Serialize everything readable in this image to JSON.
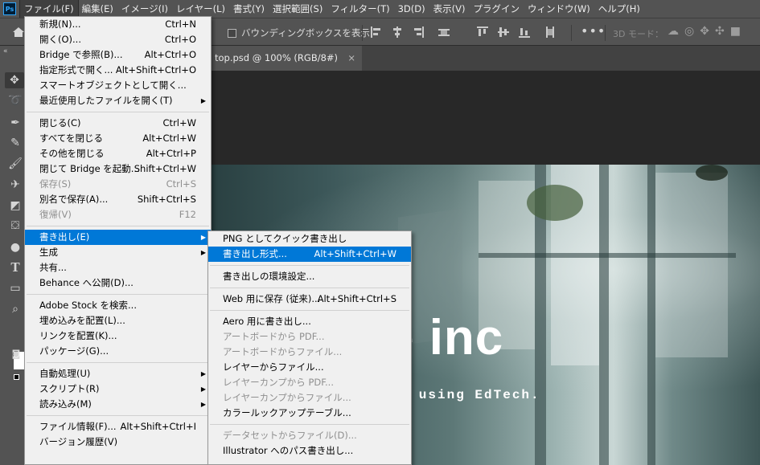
{
  "menubar": {
    "logo": "Ps",
    "items": [
      "ファイル(F)",
      "編集(E)",
      "イメージ(I)",
      "レイヤー(L)",
      "書式(Y)",
      "選択範囲(S)",
      "フィルター(T)",
      "3D(D)",
      "表示(V)",
      "プラグイン",
      "ウィンドウ(W)",
      "ヘルプ(H)"
    ]
  },
  "options": {
    "bbox_label": "バウンディングボックスを表示",
    "more": "•••",
    "mode3d": "3D モード："
  },
  "document": {
    "tab_label": "top.psd @ 100% (RGB/8#)",
    "close": "×"
  },
  "canvas": {
    "title_fragment": "e inc",
    "subtitle_fragment": "by using EdTech."
  },
  "file_menu": [
    {
      "label": "新規(N)...",
      "shortcut": "Ctrl+N"
    },
    {
      "label": "開く(O)...",
      "shortcut": "Ctrl+O"
    },
    {
      "label": "Bridge で参照(B)...",
      "shortcut": "Alt+Ctrl+O"
    },
    {
      "label": "指定形式で開く...",
      "shortcut": "Alt+Shift+Ctrl+O"
    },
    {
      "label": "スマートオブジェクトとして開く...",
      "shortcut": ""
    },
    {
      "label": "最近使用したファイルを開く(T)",
      "shortcut": "",
      "submenu": true
    },
    {
      "sep": true
    },
    {
      "label": "閉じる(C)",
      "shortcut": "Ctrl+W"
    },
    {
      "label": "すべてを閉じる",
      "shortcut": "Alt+Ctrl+W"
    },
    {
      "label": "その他を閉じる",
      "shortcut": "Alt+Ctrl+P"
    },
    {
      "label": "閉じて Bridge を起動...",
      "shortcut": "Shift+Ctrl+W"
    },
    {
      "label": "保存(S)",
      "shortcut": "Ctrl+S",
      "disabled": true
    },
    {
      "label": "別名で保存(A)...",
      "shortcut": "Shift+Ctrl+S"
    },
    {
      "label": "復帰(V)",
      "shortcut": "F12",
      "disabled": true
    },
    {
      "sep": true
    },
    {
      "label": "書き出し(E)",
      "shortcut": "",
      "submenu": true,
      "highlighted": true
    },
    {
      "label": "生成",
      "shortcut": "",
      "submenu": true
    },
    {
      "label": "共有...",
      "shortcut": ""
    },
    {
      "label": "Behance へ公開(D)...",
      "shortcut": ""
    },
    {
      "sep": true
    },
    {
      "label": "Adobe Stock を検索...",
      "shortcut": ""
    },
    {
      "label": "埋め込みを配置(L)...",
      "shortcut": ""
    },
    {
      "label": "リンクを配置(K)...",
      "shortcut": ""
    },
    {
      "label": "パッケージ(G)...",
      "shortcut": ""
    },
    {
      "sep": true
    },
    {
      "label": "自動処理(U)",
      "shortcut": "",
      "submenu": true
    },
    {
      "label": "スクリプト(R)",
      "shortcut": "",
      "submenu": true
    },
    {
      "label": "読み込み(M)",
      "shortcut": "",
      "submenu": true
    },
    {
      "sep": true
    },
    {
      "label": "ファイル情報(F)...",
      "shortcut": "Alt+Shift+Ctrl+I"
    },
    {
      "label": "バージョン履歴(V)",
      "shortcut": ""
    }
  ],
  "export_menu": [
    {
      "label": "PNG としてクイック書き出し",
      "shortcut": ""
    },
    {
      "label": "書き出し形式...",
      "shortcut": "Alt+Shift+Ctrl+W",
      "highlighted": true
    },
    {
      "sep": true
    },
    {
      "label": "書き出しの環境設定...",
      "shortcut": ""
    },
    {
      "sep": true
    },
    {
      "label": "Web 用に保存 (従来)...",
      "shortcut": "Alt+Shift+Ctrl+S"
    },
    {
      "sep": true
    },
    {
      "label": "Aero 用に書き出し...",
      "shortcut": ""
    },
    {
      "label": "アートボードから PDF...",
      "shortcut": "",
      "disabled": true
    },
    {
      "label": "アートボードからファイル...",
      "shortcut": "",
      "disabled": true
    },
    {
      "label": "レイヤーからファイル...",
      "shortcut": ""
    },
    {
      "label": "レイヤーカンプから PDF...",
      "shortcut": "",
      "disabled": true
    },
    {
      "label": "レイヤーカンプからファイル...",
      "shortcut": "",
      "disabled": true
    },
    {
      "label": "カラールックアップテーブル...",
      "shortcut": ""
    },
    {
      "sep": true
    },
    {
      "label": "データセットからファイル(D)...",
      "shortcut": "",
      "disabled": true
    },
    {
      "label": "Illustrator へのパス書き出し...",
      "shortcut": ""
    }
  ],
  "tools": [
    "move-tool",
    "lasso-tool",
    "pen-tool",
    "eyedropper-tool",
    "brush-tool",
    "clone-stamp-tool",
    "eraser-tool",
    "paint-bucket-tool",
    "dodge-tool",
    "type-tool",
    "rectangle-tool",
    "zoom-tool"
  ],
  "colors": {
    "menu_highlight": "#0078d7",
    "ui_panel": "#535353",
    "menu_bg": "#f0f0f0"
  }
}
